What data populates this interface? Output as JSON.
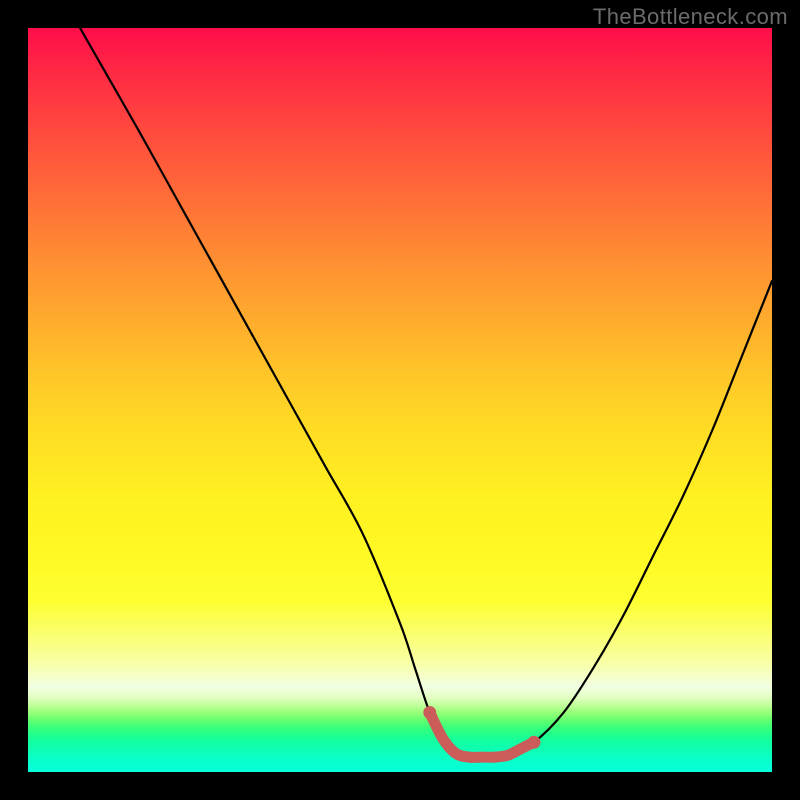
{
  "watermark": "TheBottleneck.com",
  "colors": {
    "curve": "#000000",
    "accent": "#cc5c5a",
    "frame": "#000000"
  },
  "chart_data": {
    "type": "line",
    "title": "",
    "xlabel": "",
    "ylabel": "",
    "xlim": [
      0,
      100
    ],
    "ylim": [
      0,
      100
    ],
    "grid": false,
    "series": [
      {
        "name": "bottleneck-curve",
        "x": [
          7,
          11,
          15,
          20,
          25,
          30,
          35,
          40,
          45,
          50,
          52,
          54,
          56,
          58,
          60,
          64,
          68,
          72,
          76,
          80,
          84,
          88,
          92,
          96,
          100
        ],
        "y": [
          100,
          93,
          86,
          77,
          68,
          59,
          50,
          41,
          32,
          20,
          14,
          8,
          4,
          2,
          2,
          2,
          4,
          8,
          14,
          21,
          29,
          37,
          46,
          56,
          66
        ]
      }
    ],
    "highlight": {
      "name": "optimal-range",
      "x_start": 54,
      "x_end": 68,
      "y": 2
    }
  }
}
